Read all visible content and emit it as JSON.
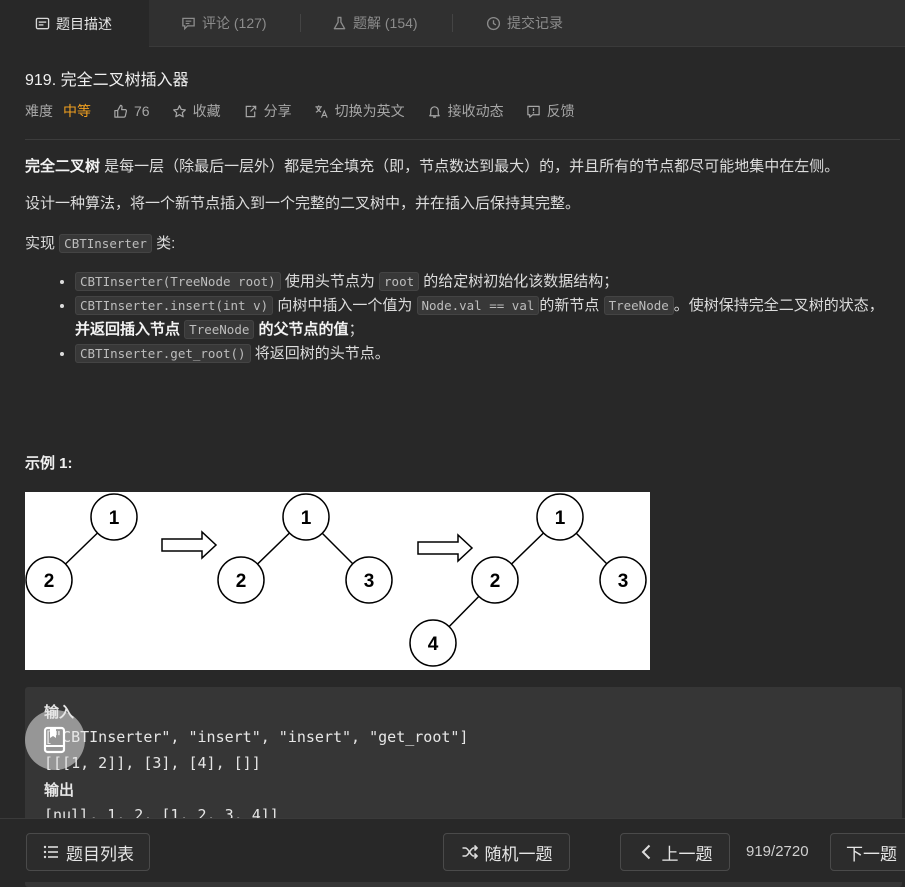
{
  "tabs": [
    {
      "label": "题目描述",
      "icon": "description-icon"
    },
    {
      "label": "评论 (127)",
      "icon": "comment-icon"
    },
    {
      "label": "题解 (154)",
      "icon": "flask-icon"
    },
    {
      "label": "提交记录",
      "icon": "clock-icon"
    }
  ],
  "problem": {
    "title": "919. 完全二叉树插入器",
    "difficulty_label": "难度",
    "difficulty": "中等",
    "likes": "76",
    "favorite_label": "收藏",
    "share_label": "分享",
    "switch_lang_label": "切换为英文",
    "subscribe_label": "接收动态",
    "feedback_label": "反馈"
  },
  "description": {
    "p1_bold": "完全二叉树",
    "p1_rest": " 是每一层（除最后一层外）都是完全填充（即，节点数达到最大）的，并且所有的节点都尽可能地集中在左侧。",
    "p2": "设计一种算法，将一个新节点插入到一个完整的二叉树中，并在插入后保持其完整。",
    "p3_pre": "实现 ",
    "p3_code": "CBTInserter",
    "p3_post": " 类:",
    "li1_code": "CBTInserter(TreeNode root)",
    "li1_t1": " 使用头节点为 ",
    "li1_code2": "root",
    "li1_t2": " 的给定树初始化该数据结构；",
    "li2_code": "CBTInserter.insert(int v)",
    "li2_t1": "  向树中插入一个值为 ",
    "li2_code2": "Node.val == val",
    "li2_t2": "的新节点 ",
    "li2_code3": "TreeNode",
    "li2_t3": "。使树保持完全二叉树的状态，",
    "li2_b1": "并返回插入节点 ",
    "li2_code4": "TreeNode",
    "li2_b2": " 的父节点的值",
    "li2_t4": "；",
    "li3_code": "CBTInserter.get_root()",
    "li3_t1": " 将返回树的头节点。"
  },
  "example": {
    "title": "示例 1:",
    "figure_nodes": [
      "1",
      "2",
      "1",
      "2",
      "3",
      "1",
      "2",
      "3",
      "4"
    ],
    "input_label": "输入",
    "input_line1": "[\"CBTInserter\", \"insert\", \"insert\", \"get_root\"]",
    "input_line2": "[[[1, 2]], [3], [4], []]",
    "output_label": "输出",
    "output_line1": "[null, 1, 2, [1, 2, 3, 4]]"
  },
  "bottom": {
    "list_label": "题目列表",
    "random_label": "随机一题",
    "prev_label": "上一题",
    "counter": "919/2720",
    "next_label": "下一题"
  },
  "colors": {
    "accent_medium": "#f0a020",
    "background": "#282828"
  }
}
